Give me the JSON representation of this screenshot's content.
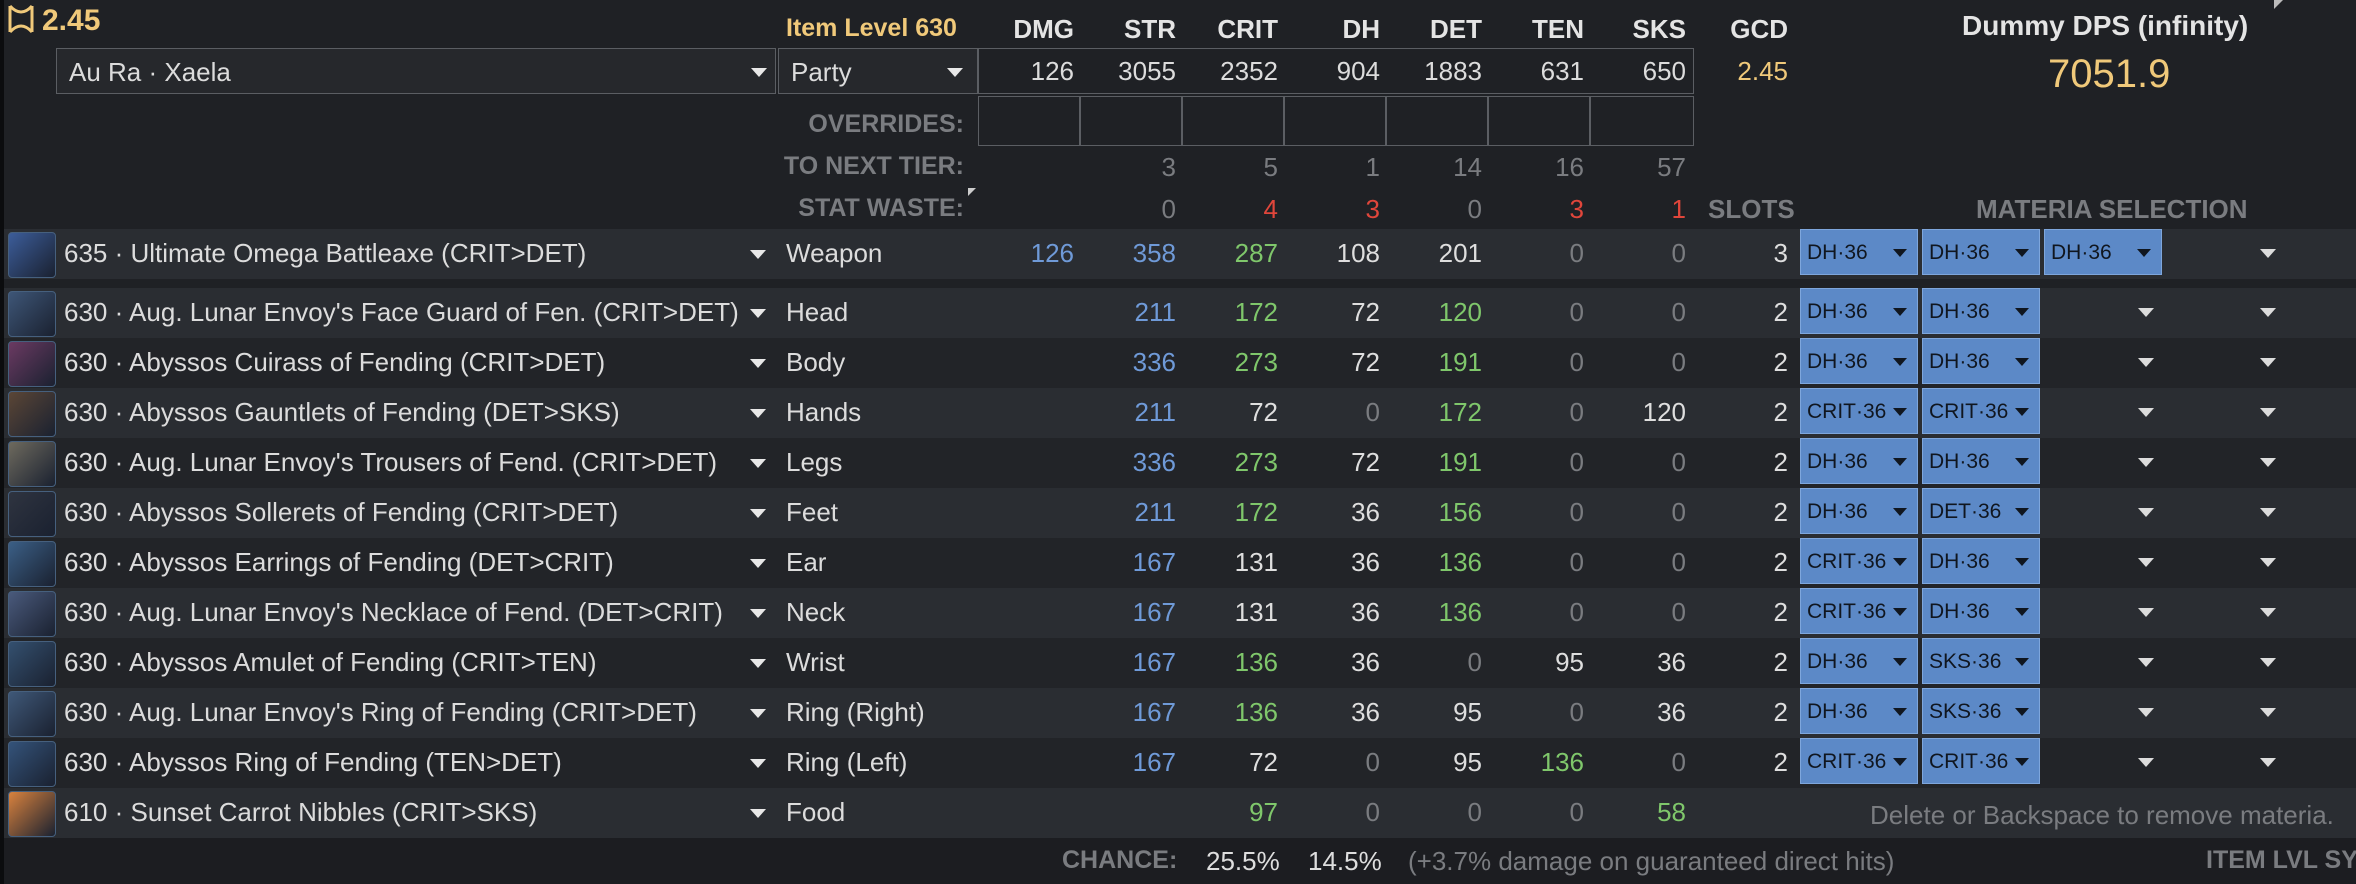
{
  "header": {
    "gcd_display": "2.45",
    "item_level": "Item Level 630",
    "columns": [
      "DMG",
      "STR",
      "CRIT",
      "DH",
      "DET",
      "TEN",
      "SKS",
      "GCD"
    ],
    "race_select": "Au Ra · Xaela",
    "party_select": "Party",
    "totals": [
      "126",
      "3055",
      "2352",
      "904",
      "1883",
      "631",
      "650",
      "2.45"
    ],
    "dps_title": "Dummy DPS (infinity)",
    "dps_value": "7051.9"
  },
  "meta_rows": {
    "overrides_label": "OVERRIDES:",
    "next_tier_label": "TO NEXT TIER:",
    "next_tier_values": [
      "3",
      "5",
      "1",
      "14",
      "16",
      "57"
    ],
    "stat_waste_label": "STAT WASTE:",
    "stat_waste_values": [
      "0",
      "4",
      "3",
      "0",
      "3",
      "1"
    ],
    "slots_label": "SLOTS",
    "materia_label": "MATERIA SELECTION"
  },
  "gear": [
    {
      "name": "635 · Ultimate Omega Battleaxe (CRIT>DET)",
      "slot": "Weapon",
      "dmg": "126",
      "str": "358",
      "crit": "287",
      "dh": "108",
      "det": "201",
      "ten": "0",
      "sks": "0",
      "slots": "3",
      "materia": [
        "DH·36",
        "DH·36",
        "DH·36"
      ],
      "icon": "axe-icon",
      "icolor": "#3c5d9a"
    },
    {
      "name": "630 · Aug. Lunar Envoy's Face Guard of Fen. (CRIT>DET)",
      "slot": "Head",
      "dmg": "",
      "str": "211",
      "crit": "172",
      "dh": "72",
      "det": "120",
      "ten": "0",
      "sks": "0",
      "slots": "2",
      "materia": [
        "DH·36",
        "DH·36"
      ],
      "icon": "helmet-icon",
      "icolor": "#3e5677"
    },
    {
      "name": "630 · Abyssos Cuirass of Fending (CRIT>DET)",
      "slot": "Body",
      "dmg": "",
      "str": "336",
      "crit": "273",
      "dh": "72",
      "det": "191",
      "ten": "0",
      "sks": "0",
      "slots": "2",
      "materia": [
        "DH·36",
        "DH·36"
      ],
      "icon": "cuirass-icon",
      "icolor": "#6b3a62"
    },
    {
      "name": "630 · Abyssos Gauntlets of Fending (DET>SKS)",
      "slot": "Hands",
      "dmg": "",
      "str": "211",
      "crit": "72",
      "dh": "0",
      "det": "172",
      "ten": "0",
      "sks": "120",
      "slots": "2",
      "materia": [
        "CRIT·36",
        "CRIT·36"
      ],
      "icon": "gauntlets-icon",
      "icolor": "#5b4636"
    },
    {
      "name": "630 · Aug. Lunar Envoy's Trousers of Fend. (CRIT>DET)",
      "slot": "Legs",
      "dmg": "",
      "str": "336",
      "crit": "273",
      "dh": "72",
      "det": "191",
      "ten": "0",
      "sks": "0",
      "slots": "2",
      "materia": [
        "DH·36",
        "DH·36"
      ],
      "icon": "trousers-icon",
      "icolor": "#6e6a5e"
    },
    {
      "name": "630 · Abyssos Sollerets of Fending (CRIT>DET)",
      "slot": "Feet",
      "dmg": "",
      "str": "211",
      "crit": "172",
      "dh": "36",
      "det": "156",
      "ten": "0",
      "sks": "0",
      "slots": "2",
      "materia": [
        "DH·36",
        "DET·36"
      ],
      "icon": "boots-icon",
      "icolor": "#2f3440"
    },
    {
      "name": "630 · Abyssos Earrings of Fending (DET>CRIT)",
      "slot": "Ear",
      "dmg": "",
      "str": "167",
      "crit": "131",
      "dh": "36",
      "det": "136",
      "ten": "0",
      "sks": "0",
      "slots": "2",
      "materia": [
        "CRIT·36",
        "DH·36"
      ],
      "icon": "earring-icon",
      "icolor": "#3b5f86"
    },
    {
      "name": "630 · Aug. Lunar Envoy's Necklace of Fend. (DET>CRIT)",
      "slot": "Neck",
      "dmg": "",
      "str": "167",
      "crit": "131",
      "dh": "36",
      "det": "136",
      "ten": "0",
      "sks": "0",
      "slots": "2",
      "materia": [
        "CRIT·36",
        "DH·36"
      ],
      "icon": "necklace-icon",
      "icolor": "#4a5a7c"
    },
    {
      "name": "630 · Abyssos Amulet of Fending (CRIT>TEN)",
      "slot": "Wrist",
      "dmg": "",
      "str": "167",
      "crit": "136",
      "dh": "36",
      "det": "0",
      "ten": "95",
      "sks": "36",
      "slots": "2",
      "materia": [
        "DH·36",
        "SKS·36"
      ],
      "icon": "bracelet-icon",
      "icolor": "#34506f"
    },
    {
      "name": "630 · Aug. Lunar Envoy's Ring of Fending (CRIT>DET)",
      "slot": "Ring (Right)",
      "dmg": "",
      "str": "167",
      "crit": "136",
      "dh": "36",
      "det": "95",
      "ten": "0",
      "sks": "36",
      "slots": "2",
      "materia": [
        "DH·36",
        "SKS·36"
      ],
      "icon": "ring-icon",
      "icolor": "#3f5878"
    },
    {
      "name": "630 · Abyssos Ring of Fending (TEN>DET)",
      "slot": "Ring (Left)",
      "dmg": "",
      "str": "167",
      "crit": "72",
      "dh": "0",
      "det": "95",
      "ten": "136",
      "sks": "0",
      "slots": "2",
      "materia": [
        "CRIT·36",
        "CRIT·36"
      ],
      "icon": "ring-icon",
      "icolor": "#34537a"
    },
    {
      "name": "610 · Sunset Carrot Nibbles (CRIT>SKS)",
      "slot": "Food",
      "dmg": "",
      "str": "",
      "crit": "97",
      "dh": "0",
      "det": "0",
      "ten": "0",
      "sks": "58",
      "slots": "",
      "materia": [],
      "icon": "food-icon",
      "icolor": "#d9823e"
    }
  ],
  "footer": {
    "hint": "Delete or Backspace to remove materia.",
    "chance_label": "CHANCE:",
    "chance_crit": "25.5%",
    "chance_dh": "14.5%",
    "dh_note": "(+3.7% damage on guaranteed direct hits)",
    "item_lvl": "ITEM LVL SY"
  },
  "colors": {
    "blue": "#6f9ad8",
    "green": "#7fc76b",
    "red": "#e0463b",
    "gold": "#f0c97a",
    "materia": "#5c89c7"
  }
}
